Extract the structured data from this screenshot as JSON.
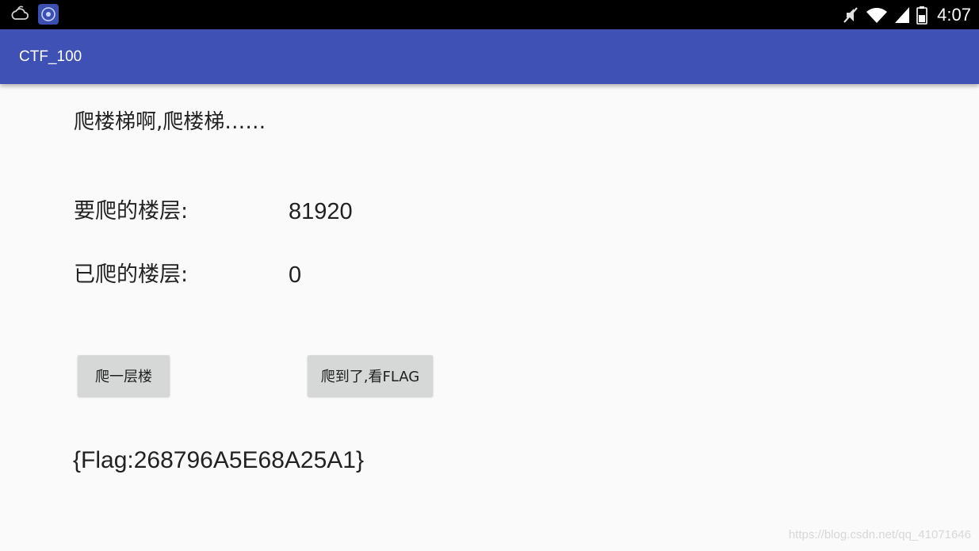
{
  "status_bar": {
    "time": "4:07",
    "icons": [
      "weather-icon",
      "app-notification-icon",
      "mute-icon",
      "wifi-icon",
      "signal-icon",
      "battery-icon"
    ]
  },
  "app_bar": {
    "title": "CTF_100",
    "color": "#3f51b5"
  },
  "main": {
    "heading": "爬楼梯啊,爬楼梯……",
    "target_floors_label": "要爬的楼层:",
    "target_floors_value": "81920",
    "climbed_floors_label": "已爬的楼层:",
    "climbed_floors_value": "0",
    "climb_button_label": "爬一层楼",
    "view_flag_button_label": "爬到了,看FLAG",
    "flag_text": "{Flag:268796A5E68A25A1}"
  },
  "watermark": "https://blog.csdn.net/qq_41071646"
}
